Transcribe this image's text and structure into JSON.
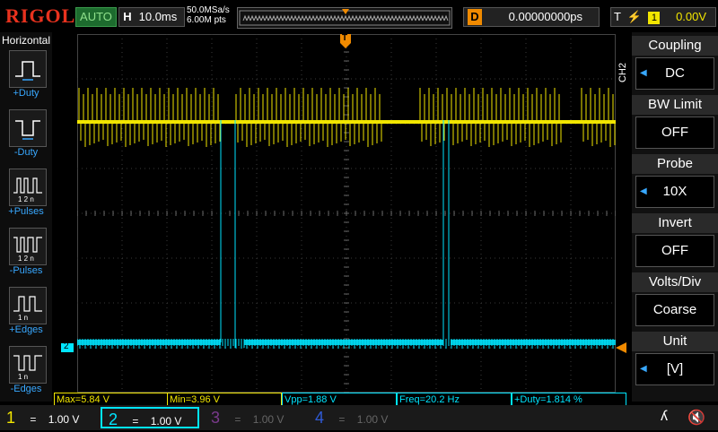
{
  "brand": "RIGOL",
  "run_state": "AUTO",
  "horizontal": {
    "label": "H",
    "timebase": "10.0ms",
    "sample_rate": "50.0MSa/s",
    "points": "6.00M pts"
  },
  "delay": {
    "label": "D",
    "value": "0.00000000ps"
  },
  "trigger": {
    "label": "T",
    "source": "1",
    "level": "0.00V"
  },
  "left_panel": {
    "title": "Horizontal",
    "items": [
      {
        "label": "+Duty",
        "icon": "positive-duty-icon"
      },
      {
        "label": "-Duty",
        "icon": "negative-duty-icon"
      },
      {
        "label": "+Pulses",
        "icon": "positive-pulses-icon"
      },
      {
        "label": "-Pulses",
        "icon": "negative-pulses-icon"
      },
      {
        "label": "+Edges",
        "icon": "positive-edges-icon"
      },
      {
        "label": "-Edges",
        "icon": "negative-edges-icon"
      }
    ]
  },
  "right_menu": {
    "channel": "CH2",
    "items": [
      {
        "header": "Coupling",
        "value": "DC"
      },
      {
        "header": "BW Limit",
        "value": "OFF"
      },
      {
        "header": "Probe",
        "value": "10X"
      },
      {
        "header": "Invert",
        "value": "OFF"
      },
      {
        "header": "Volts/Div",
        "value": "Coarse"
      },
      {
        "header": "Unit",
        "value": "[V]"
      }
    ]
  },
  "measurements": [
    {
      "text": "Max=5.84 V",
      "color": "#f2e600"
    },
    {
      "text": "Min=3.96 V",
      "color": "#f2e600"
    },
    {
      "text": "Vpp=1.88 V",
      "color": "#00e5ff"
    },
    {
      "text": "Freq=20.2 Hz",
      "color": "#00e5ff"
    },
    {
      "text": "+Duty=1.814 %",
      "color": "#00e5ff"
    }
  ],
  "channels": [
    {
      "num": "1",
      "coupling": "=",
      "scale": "1.00 V",
      "color": "#f2e600",
      "active": true
    },
    {
      "num": "2",
      "coupling": "=",
      "scale": "1.00 V",
      "color": "#00e5ff",
      "active": true
    },
    {
      "num": "3",
      "coupling": "=",
      "scale": "1.00 V",
      "color": "#b04ac8",
      "active": false
    },
    {
      "num": "4",
      "coupling": "=",
      "scale": "1.00 V",
      "color": "#2f5bd6",
      "active": false
    }
  ],
  "markers": {
    "ch2": "2",
    "trigger_pos": "T"
  },
  "colors": {
    "ch1": "#f2e600",
    "ch2": "#00e5ff",
    "accent": "#f08a00",
    "brand": "#e8321e"
  }
}
